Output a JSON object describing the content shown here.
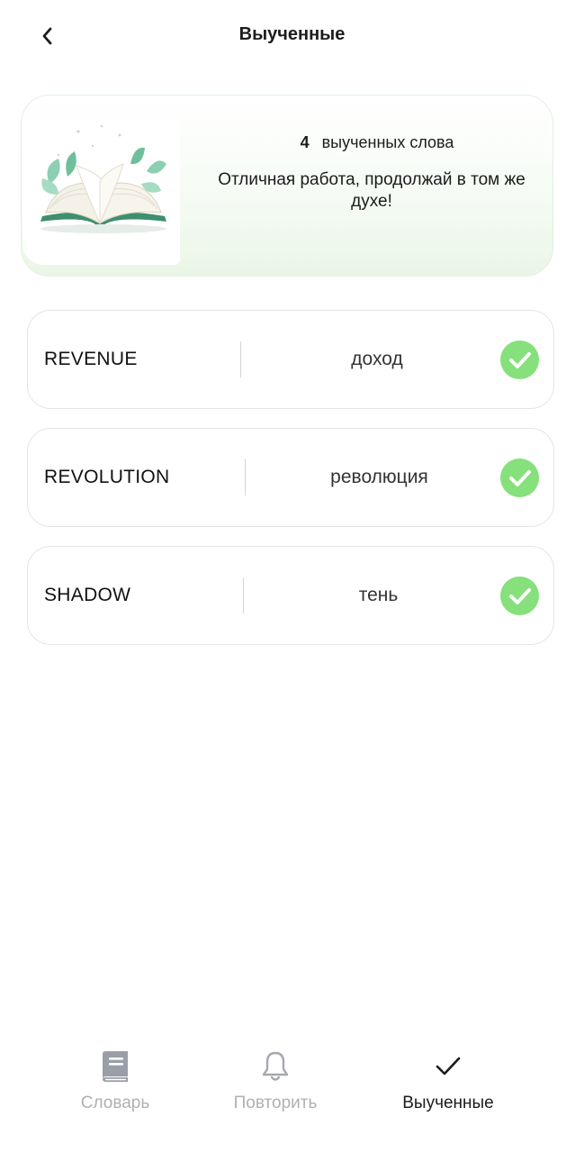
{
  "header": {
    "title": "Выученные"
  },
  "banner": {
    "count": "4",
    "count_label": "выученных слова",
    "message": "Отличная работа, продолжай в том же духе!"
  },
  "words": [
    {
      "en": "REVENUE",
      "ru": "доход"
    },
    {
      "en": "REVOLUTION",
      "ru": "революция"
    },
    {
      "en": "SHADOW",
      "ru": "тень"
    }
  ],
  "tabs": [
    {
      "label": "Словарь",
      "icon": "book-icon",
      "active": false
    },
    {
      "label": "Повторить",
      "icon": "bell-icon",
      "active": false
    },
    {
      "label": "Выученные",
      "icon": "checkmark-icon",
      "active": true
    }
  ],
  "colors": {
    "check_green": "#86e07c",
    "inactive_tab": "#b0b0b0",
    "active_tab": "#1c1c1c"
  }
}
